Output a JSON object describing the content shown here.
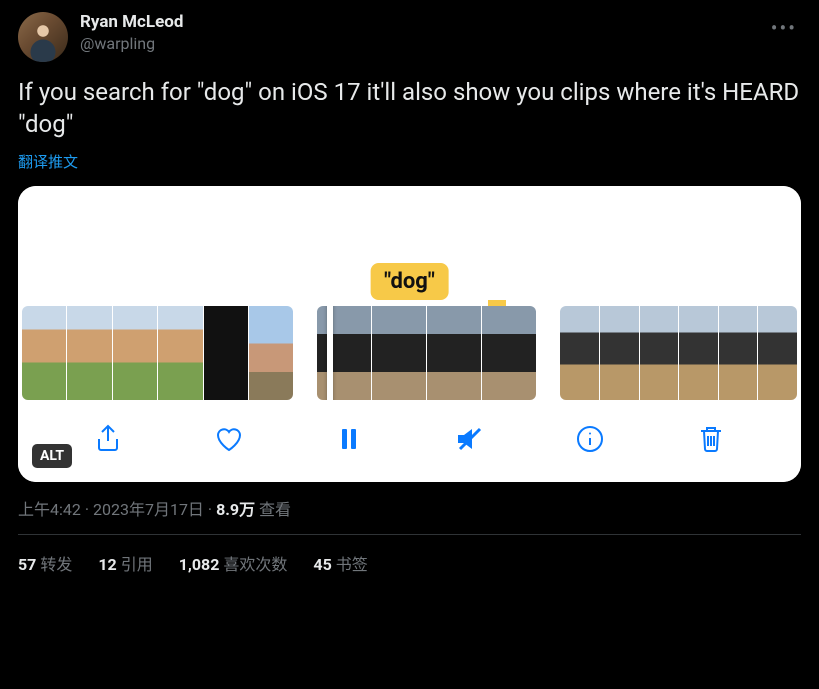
{
  "author": {
    "display_name": "Ryan McLeod",
    "handle": "@warpling"
  },
  "body": "If you search for \"dog\" on iOS 17 it'll also show you clips where it's HEARD \"dog\"",
  "translate_label": "翻译推文",
  "media": {
    "caption_pill": "\"dog\"",
    "alt_badge": "ALT"
  },
  "meta": {
    "time": "上午4:42",
    "date": "2023年7月17日",
    "separator": " · ",
    "views_num": "8.9万",
    "views_label": " 查看"
  },
  "stats": {
    "retweets_num": "57",
    "retweets_label": "转发",
    "quotes_num": "12",
    "quotes_label": "引用",
    "likes_num": "1,082",
    "likes_label": "喜欢次数",
    "bookmarks_num": "45",
    "bookmarks_label": "书签"
  }
}
